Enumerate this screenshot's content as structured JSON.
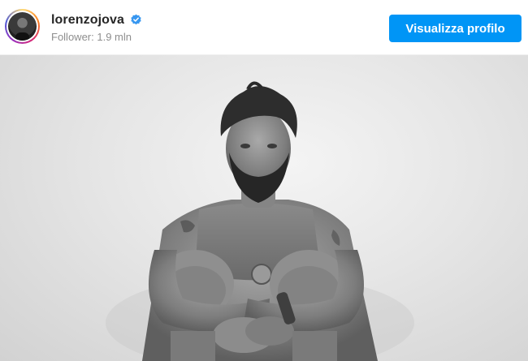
{
  "post_header": {
    "username": "lorenzojova",
    "followers": "Follower: 1.9 mln",
    "verified": true,
    "view_profile_label": "Visualizza profilo"
  },
  "photo": {
    "subject": "black-and-white portrait of a bearded man sitting against a white wall, arms wrapped around knees"
  },
  "colors": {
    "button_bg": "#0095f6",
    "verified_badge": "#3897f0",
    "username": "#262626",
    "followers": "#8e8e8e"
  }
}
